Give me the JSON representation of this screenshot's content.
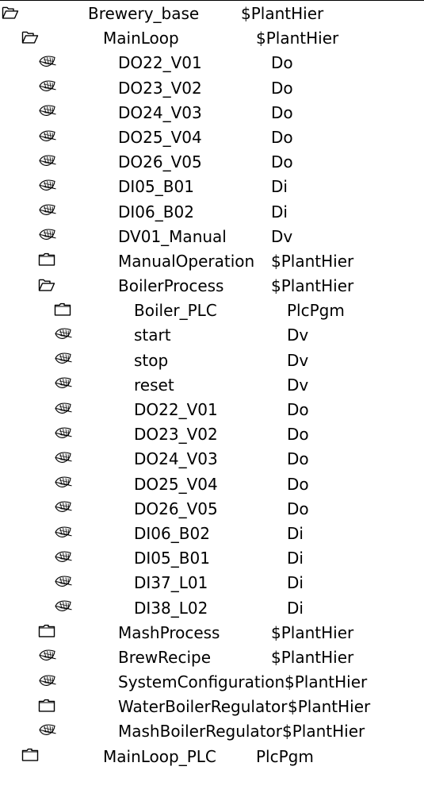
{
  "tree": [
    {
      "level": 0,
      "icon": "folder-open-icon",
      "name": "Brewery_base",
      "class": "$PlantHier"
    },
    {
      "level": 1,
      "icon": "folder-open-icon",
      "name": "MainLoop",
      "class": "$PlantHier"
    },
    {
      "level": 2,
      "icon": "leaf-icon",
      "name": "DO22_V01",
      "class": "Do"
    },
    {
      "level": 2,
      "icon": "leaf-icon",
      "name": "DO23_V02",
      "class": "Do"
    },
    {
      "level": 2,
      "icon": "leaf-icon",
      "name": "DO24_V03",
      "class": "Do"
    },
    {
      "level": 2,
      "icon": "leaf-icon",
      "name": "DO25_V04",
      "class": "Do"
    },
    {
      "level": 2,
      "icon": "leaf-icon",
      "name": "DO26_V05",
      "class": "Do"
    },
    {
      "level": 2,
      "icon": "leaf-icon",
      "name": "DI05_B01",
      "class": "Di"
    },
    {
      "level": 2,
      "icon": "leaf-icon",
      "name": "DI06_B02",
      "class": "Di"
    },
    {
      "level": 2,
      "icon": "leaf-icon",
      "name": "DV01_Manual",
      "class": "Dv"
    },
    {
      "level": 2,
      "icon": "folder-closed-icon",
      "name": "ManualOperation",
      "class": "$PlantHier"
    },
    {
      "level": 2,
      "icon": "folder-open-icon",
      "name": "BoilerProcess",
      "class": "$PlantHier"
    },
    {
      "level": 3,
      "icon": "folder-closed-icon",
      "name": "Boiler_PLC",
      "class": "PlcPgm"
    },
    {
      "level": 3,
      "icon": "leaf-icon",
      "name": "start",
      "class": "Dv"
    },
    {
      "level": 3,
      "icon": "leaf-icon",
      "name": "stop",
      "class": "Dv"
    },
    {
      "level": 3,
      "icon": "leaf-icon",
      "name": "reset",
      "class": "Dv"
    },
    {
      "level": 3,
      "icon": "leaf-icon",
      "name": "DO22_V01",
      "class": "Do"
    },
    {
      "level": 3,
      "icon": "leaf-icon",
      "name": "DO23_V02",
      "class": "Do"
    },
    {
      "level": 3,
      "icon": "leaf-icon",
      "name": "DO24_V03",
      "class": "Do"
    },
    {
      "level": 3,
      "icon": "leaf-icon",
      "name": "DO25_V04",
      "class": "Do"
    },
    {
      "level": 3,
      "icon": "leaf-icon",
      "name": "DO26_V05",
      "class": "Do"
    },
    {
      "level": 3,
      "icon": "leaf-icon",
      "name": "DI06_B02",
      "class": "Di"
    },
    {
      "level": 3,
      "icon": "leaf-icon",
      "name": "DI05_B01",
      "class": "Di"
    },
    {
      "level": 3,
      "icon": "leaf-icon",
      "name": "DI37_L01",
      "class": "Di"
    },
    {
      "level": 3,
      "icon": "leaf-icon",
      "name": "DI38_L02",
      "class": "Di"
    },
    {
      "level": 2,
      "icon": "folder-closed-icon",
      "name": "MashProcess",
      "class": "$PlantHier"
    },
    {
      "level": 2,
      "icon": "leaf-icon",
      "name": "BrewRecipe",
      "class": "$PlantHier"
    },
    {
      "level": 2,
      "icon": "leaf-icon",
      "name": "SystemConfiguration",
      "class": "$PlantHier"
    },
    {
      "level": 2,
      "icon": "folder-closed-icon",
      "name": "WaterBoilerRegulator",
      "class": "$PlantHier"
    },
    {
      "level": 2,
      "icon": "leaf-icon",
      "name": "MashBoilerRegulator",
      "class": "$PlantHier"
    },
    {
      "level": 1,
      "icon": "folder-closed-icon",
      "name": "MainLoop_PLC",
      "class": "PlcPgm"
    }
  ]
}
